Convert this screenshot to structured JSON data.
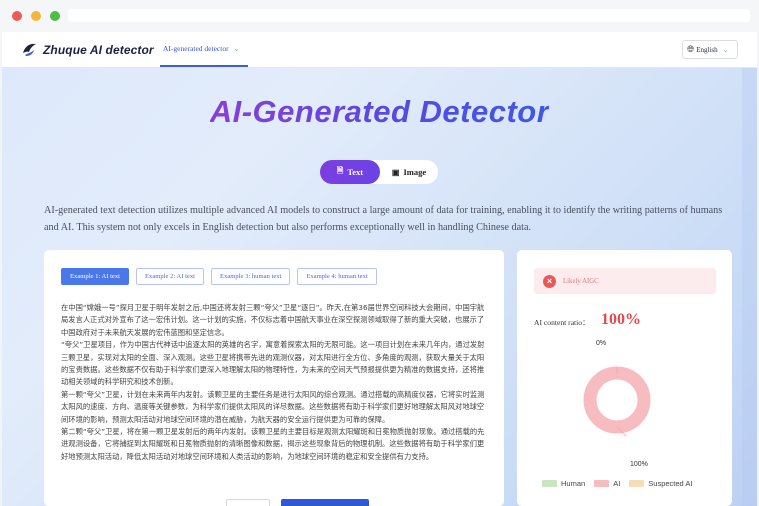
{
  "browser": {
    "dots": [
      "red",
      "yellow",
      "green"
    ]
  },
  "navbar": {
    "logo_text": "Zhuque AI detector",
    "nav_item": "AI-generated detector",
    "language": "English"
  },
  "hero": {
    "title": "AI-Generated Detector",
    "tabs": [
      {
        "label": "Text",
        "icon": "document-icon",
        "active": true
      },
      {
        "label": "Image",
        "icon": "image-icon",
        "active": false
      }
    ],
    "description": "AI-generated text detection utilizes multiple advanced AI models to construct a large amount of data for training, enabling it to identify the writing patterns of humans and AI. This system not only excels in English detection but also performs exceptionally well in handling Chinese data."
  },
  "examples": [
    {
      "label": "Example 1: AI text",
      "active": true
    },
    {
      "label": "Example 2: AI text",
      "active": false
    },
    {
      "label": "Example 3: human text",
      "active": false
    },
    {
      "label": "Example 4: human text",
      "active": false
    }
  ],
  "input_text": {
    "paragraphs": [
      "在中国“嫦娥一号”探月卫星于明年发射之后,中国还将发射三颗“夸父”卫星“逐日”。昨天,在第36届世界空间科技大会期间，中国宇航局发言人正式对外宣布了这一宏伟计划。这一计划的实施，不仅标志着中国航天事业在深空探测领域取得了新的重大突破，也展示了中国政府对于未来航天发展的宏伟蓝图和坚定信念。",
      "“夸父”卫星项目，作为中国古代神话中追逐太阳的英雄的名字，寓意着探索太阳的无限可能。这一项目计划在未来几年内，通过发射三颗卫星，实现对太阳的全面、深入观测。这些卫星将携带先进的观测仪器，对太阳进行全方位、多角度的观测，获取大量关于太阳的宝贵数据。这些数据不仅有助于科学家们更深入地理解太阳的物理特性，为未来的空间天气预报提供更为精准的数据支持，还将推动相关领域的科学研究和技术创新。",
      "第一颗“夸父”卫星，计划在未来两年内发射。该颗卫星的主要任务是进行太阳风的综合观测。通过搭载的高精度仪器，它将实时监测太阳风的速度、方向、温度等关键参数，为科学家们提供太阳风的详尽数据。这些数据将有助于科学家们更好地理解太阳风对地球空间环境的影响，预测太阳活动对地球空间环境的潜在威胁，为航天器的安全运行提供更为可靠的保障。",
      "第二颗“夸父”卫星，将在第一颗卫星发射后的两年内发射。该颗卫星的主要目标是观测太阳耀斑和日冕物质抛射现象。通过搭载的先进观测设备，它将捕捉到太阳耀斑和日冕物质抛射的清晰图像和数据，揭示这些现象背后的物理机制。这些数据将有助于科学家们更好地预测太阳活动，降低太阳活动对地球空间环境和人类活动的影响，为地球空间环境的稳定和安全提供有力支持。"
    ]
  },
  "result": {
    "verdict": "Likely AIGC",
    "ratio_label": "AI content ratio：",
    "ratio_value": "100%",
    "pct_top": "0%",
    "pct_bottom": "100%",
    "legend": [
      {
        "label": "Human",
        "color": "#c8e6c0"
      },
      {
        "label": "AI",
        "color": "#f6bcc0"
      },
      {
        "label": "Suspected AI",
        "color": "#f7ddb6"
      }
    ]
  },
  "chart_data": {
    "type": "pie",
    "categories": [
      "Human",
      "AI",
      "Suspected AI"
    ],
    "values": [
      0,
      100,
      0
    ],
    "colors": [
      "#c8e6c0",
      "#f6bcc0",
      "#f7ddb6"
    ]
  },
  "colors": {
    "accent": "#6a43e6",
    "link": "#3358d4",
    "danger": "#e5484d"
  }
}
